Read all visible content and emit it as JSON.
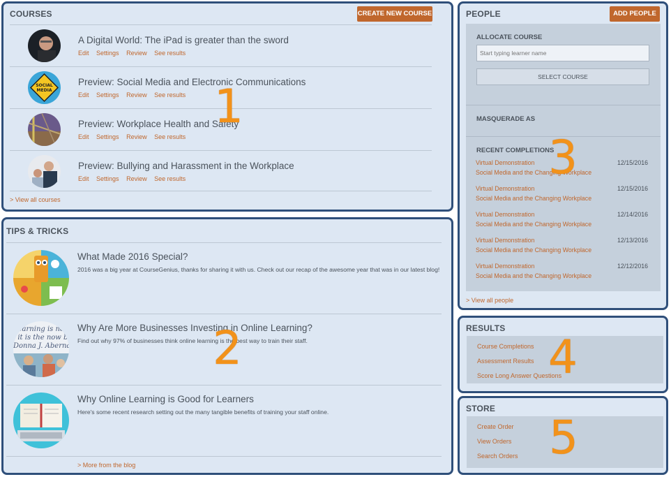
{
  "courses": {
    "title": "COURSES",
    "create_button": "CREATE NEW COURSE",
    "items": [
      {
        "title": "A Digital World: The iPad is greater than the sword",
        "links": [
          "Edit",
          "Settings",
          "Review",
          "See results"
        ]
      },
      {
        "title": "Preview: Social Media and Electronic Communications",
        "links": [
          "Edit",
          "Settings",
          "Review",
          "See results"
        ]
      },
      {
        "title": "Preview: Workplace Health and Safety",
        "links": [
          "Edit",
          "Settings",
          "Review",
          "See results"
        ]
      },
      {
        "title": "Preview: Bullying and Harassment in the Workplace",
        "links": [
          "Edit",
          "Settings",
          "Review",
          "See results"
        ]
      }
    ],
    "view_all": "> View all courses",
    "thumb_social_text": "SOCIAL MEDIA"
  },
  "tips": {
    "title": "TIPS & TRICKS",
    "items": [
      {
        "title": "What Made 2016 Special?",
        "body": "2016 was a big year at CourseGenius, thanks for sharing it with us. Check out our recap of the awesome year that was in our latest blog!"
      },
      {
        "title": "Why Are More Businesses Investing in Online Learning?",
        "body": "Find out why 97% of businesses think online learning is the best way to train their staff."
      },
      {
        "title": "Why Online Learning is Good for Learners",
        "body": "Here's some recent research setting out the many tangible benefits of training your staff online."
      }
    ],
    "more": "> More from the blog",
    "quote_text": "Learning is not th... is the now big th... Donna J. Abernathy"
  },
  "people": {
    "title": "PEOPLE",
    "add_button": "ADD PEOPLE",
    "allocate_label": "ALLOCATE COURSE",
    "learner_placeholder": "Start typing learner name",
    "select_course": "SELECT COURSE",
    "masquerade_label": "MASQUERADE AS",
    "recent_label": "RECENT COMPLETIONS",
    "completions": [
      {
        "name": "Virtual Demonstration",
        "course": "Social Media and the Changing Workplace",
        "date": "12/15/2016"
      },
      {
        "name": "Virtual Demonstration",
        "course": "Social Media and the Changing Workplace",
        "date": "12/15/2016"
      },
      {
        "name": "Virtual Demonstration",
        "course": "Social Media and the Changing Workplace",
        "date": "12/14/2016"
      },
      {
        "name": "Virtual Demonstration",
        "course": "Social Media and the Changing Workplace",
        "date": "12/13/2016"
      },
      {
        "name": "Virtual Demonstration",
        "course": "Social Media and the Changing Workplace",
        "date": "12/12/2016"
      }
    ],
    "view_all": "> View all people"
  },
  "results": {
    "title": "RESULTS",
    "links": [
      "Course Completions",
      "Assessment Results",
      "Score Long Answer Questions"
    ]
  },
  "store": {
    "title": "STORE",
    "links": [
      "Create Order",
      "View Orders",
      "Search Orders"
    ]
  },
  "annotations": [
    "1",
    "2",
    "3",
    "4",
    "5"
  ],
  "colors": {
    "accent": "#c0672d",
    "panel_bg": "#dde7f3",
    "border": "#2f4f7a",
    "number": "#f2921a"
  }
}
